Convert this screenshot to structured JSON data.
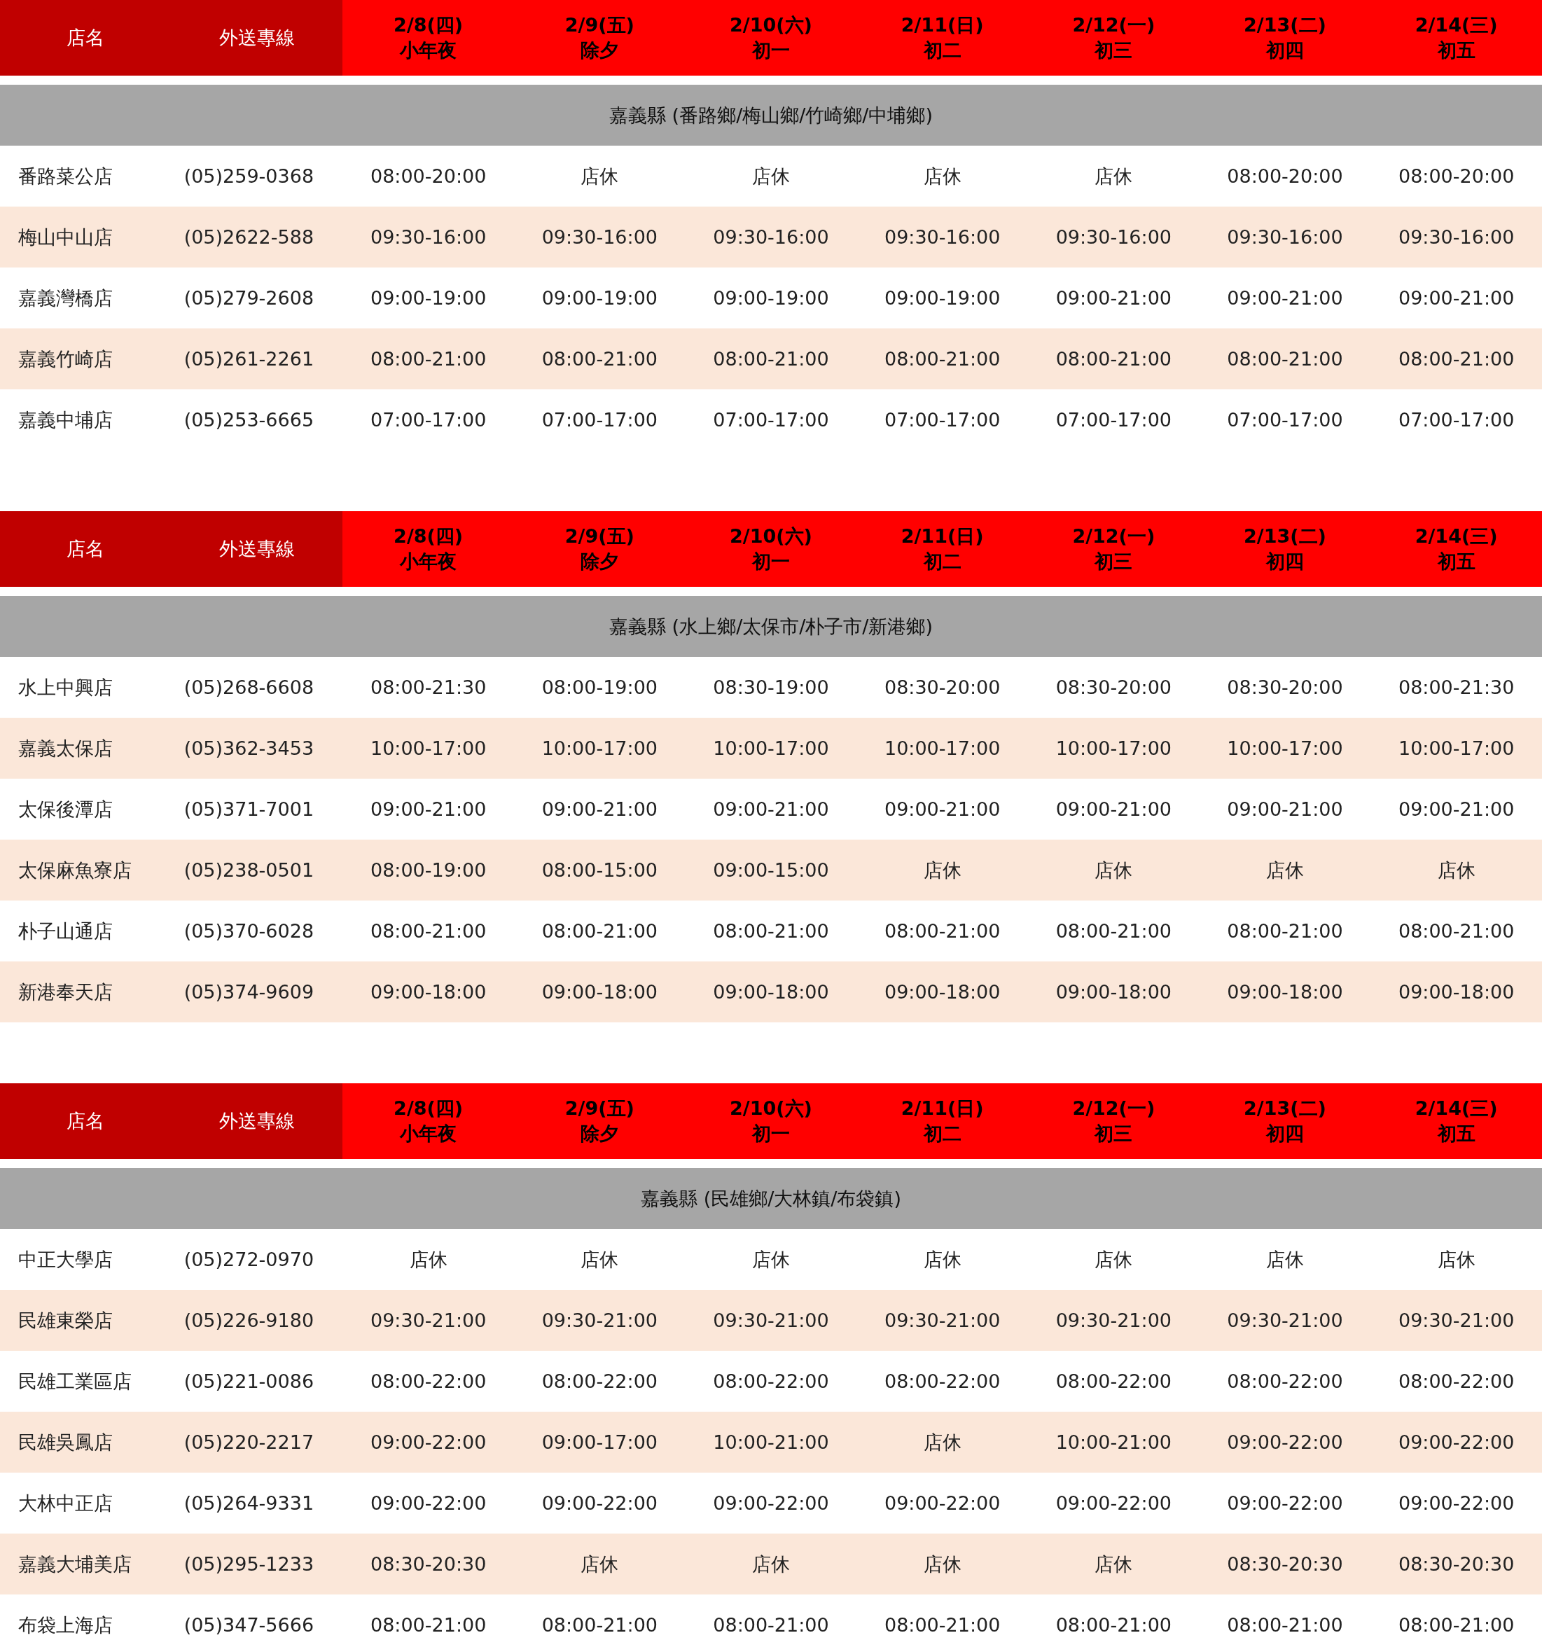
{
  "tables": [
    {
      "columns": [
        {
          "kind": "label",
          "lines": [
            "店名"
          ]
        },
        {
          "kind": "label",
          "lines": [
            "外送專線"
          ]
        },
        {
          "kind": "day",
          "lines": [
            "2/8(四)",
            "小年夜"
          ]
        },
        {
          "kind": "day",
          "lines": [
            "2/9(五)",
            "除夕"
          ]
        },
        {
          "kind": "day",
          "lines": [
            "2/10(六)",
            "初一"
          ]
        },
        {
          "kind": "day",
          "lines": [
            "2/11(日)",
            "初二"
          ]
        },
        {
          "kind": "day",
          "lines": [
            "2/12(一)",
            "初三"
          ]
        },
        {
          "kind": "day",
          "lines": [
            "2/13(二)",
            "初四"
          ]
        },
        {
          "kind": "day",
          "lines": [
            "2/14(三)",
            "初五"
          ]
        }
      ],
      "region": "嘉義縣 (番路鄉/梅山鄉/竹崎鄉/中埔鄉)",
      "rows": [
        {
          "name": "番路菜公店",
          "phone": "(05)259-0368",
          "hours": [
            "08:00-20:00",
            "店休",
            "店休",
            "店休",
            "店休",
            "08:00-20:00",
            "08:00-20:00"
          ]
        },
        {
          "name": "梅山中山店",
          "phone": "(05)2622-588",
          "hours": [
            "09:30-16:00",
            "09:30-16:00",
            "09:30-16:00",
            "09:30-16:00",
            "09:30-16:00",
            "09:30-16:00",
            "09:30-16:00"
          ]
        },
        {
          "name": "嘉義灣橋店",
          "phone": "(05)279-2608",
          "hours": [
            "09:00-19:00",
            "09:00-19:00",
            "09:00-19:00",
            "09:00-19:00",
            "09:00-21:00",
            "09:00-21:00",
            "09:00-21:00"
          ]
        },
        {
          "name": "嘉義竹崎店",
          "phone": "(05)261-2261",
          "hours": [
            "08:00-21:00",
            "08:00-21:00",
            "08:00-21:00",
            "08:00-21:00",
            "08:00-21:00",
            "08:00-21:00",
            "08:00-21:00"
          ]
        },
        {
          "name": "嘉義中埔店",
          "phone": "(05)253-6665",
          "hours": [
            "07:00-17:00",
            "07:00-17:00",
            "07:00-17:00",
            "07:00-17:00",
            "07:00-17:00",
            "07:00-17:00",
            "07:00-17:00"
          ]
        }
      ]
    },
    {
      "columns": [
        {
          "kind": "label",
          "lines": [
            "店名"
          ]
        },
        {
          "kind": "label",
          "lines": [
            "外送專線"
          ]
        },
        {
          "kind": "day",
          "lines": [
            "2/8(四)",
            "小年夜"
          ]
        },
        {
          "kind": "day",
          "lines": [
            "2/9(五)",
            "除夕"
          ]
        },
        {
          "kind": "day",
          "lines": [
            "2/10(六)",
            "初一"
          ]
        },
        {
          "kind": "day",
          "lines": [
            "2/11(日)",
            "初二"
          ]
        },
        {
          "kind": "day",
          "lines": [
            "2/12(一)",
            "初三"
          ]
        },
        {
          "kind": "day",
          "lines": [
            "2/13(二)",
            "初四"
          ]
        },
        {
          "kind": "day",
          "lines": [
            "2/14(三)",
            "初五"
          ]
        }
      ],
      "region": "嘉義縣 (水上鄉/太保市/朴子市/新港鄉)",
      "rows": [
        {
          "name": "水上中興店",
          "phone": "(05)268-6608",
          "hours": [
            "08:00-21:30",
            "08:00-19:00",
            "08:30-19:00",
            "08:30-20:00",
            "08:30-20:00",
            "08:30-20:00",
            "08:00-21:30"
          ]
        },
        {
          "name": "嘉義太保店",
          "phone": "(05)362-3453",
          "hours": [
            "10:00-17:00",
            "10:00-17:00",
            "10:00-17:00",
            "10:00-17:00",
            "10:00-17:00",
            "10:00-17:00",
            "10:00-17:00"
          ]
        },
        {
          "name": "太保後潭店",
          "phone": "(05)371-7001",
          "hours": [
            "09:00-21:00",
            "09:00-21:00",
            "09:00-21:00",
            "09:00-21:00",
            "09:00-21:00",
            "09:00-21:00",
            "09:00-21:00"
          ]
        },
        {
          "name": "太保麻魚寮店",
          "phone": "(05)238-0501",
          "hours": [
            "08:00-19:00",
            "08:00-15:00",
            "09:00-15:00",
            "店休",
            "店休",
            "店休",
            "店休"
          ]
        },
        {
          "name": "朴子山通店",
          "phone": "(05)370-6028",
          "hours": [
            "08:00-21:00",
            "08:00-21:00",
            "08:00-21:00",
            "08:00-21:00",
            "08:00-21:00",
            "08:00-21:00",
            "08:00-21:00"
          ]
        },
        {
          "name": "新港奉天店",
          "phone": "(05)374-9609",
          "hours": [
            "09:00-18:00",
            "09:00-18:00",
            "09:00-18:00",
            "09:00-18:00",
            "09:00-18:00",
            "09:00-18:00",
            "09:00-18:00"
          ]
        }
      ]
    },
    {
      "columns": [
        {
          "kind": "label",
          "lines": [
            "店名"
          ]
        },
        {
          "kind": "label",
          "lines": [
            "外送專線"
          ]
        },
        {
          "kind": "day",
          "lines": [
            "2/8(四)",
            "小年夜"
          ]
        },
        {
          "kind": "day",
          "lines": [
            "2/9(五)",
            "除夕"
          ]
        },
        {
          "kind": "day",
          "lines": [
            "2/10(六)",
            "初一"
          ]
        },
        {
          "kind": "day",
          "lines": [
            "2/11(日)",
            "初二"
          ]
        },
        {
          "kind": "day",
          "lines": [
            "2/12(一)",
            "初三"
          ]
        },
        {
          "kind": "day",
          "lines": [
            "2/13(二)",
            "初四"
          ]
        },
        {
          "kind": "day",
          "lines": [
            "2/14(三)",
            "初五"
          ]
        }
      ],
      "region": "嘉義縣 (民雄鄉/大林鎮/布袋鎮)",
      "rows": [
        {
          "name": "中正大學店",
          "phone": "(05)272-0970",
          "hours": [
            "店休",
            "店休",
            "店休",
            "店休",
            "店休",
            "店休",
            "店休"
          ]
        },
        {
          "name": "民雄東榮店",
          "phone": "(05)226-9180",
          "hours": [
            "09:30-21:00",
            "09:30-21:00",
            "09:30-21:00",
            "09:30-21:00",
            "09:30-21:00",
            "09:30-21:00",
            "09:30-21:00"
          ]
        },
        {
          "name": "民雄工業區店",
          "phone": "(05)221-0086",
          "hours": [
            "08:00-22:00",
            "08:00-22:00",
            "08:00-22:00",
            "08:00-22:00",
            "08:00-22:00",
            "08:00-22:00",
            "08:00-22:00"
          ]
        },
        {
          "name": "民雄吳鳳店",
          "phone": "(05)220-2217",
          "hours": [
            "09:00-22:00",
            "09:00-17:00",
            "10:00-21:00",
            "店休",
            "10:00-21:00",
            "09:00-22:00",
            "09:00-22:00"
          ]
        },
        {
          "name": "大林中正店",
          "phone": "(05)264-9331",
          "hours": [
            "09:00-22:00",
            "09:00-22:00",
            "09:00-22:00",
            "09:00-22:00",
            "09:00-22:00",
            "09:00-22:00",
            "09:00-22:00"
          ]
        },
        {
          "name": "嘉義大埔美店",
          "phone": "(05)295-1233",
          "hours": [
            "08:30-20:30",
            "店休",
            "店休",
            "店休",
            "店休",
            "08:30-20:30",
            "08:30-20:30"
          ]
        },
        {
          "name": "布袋上海店",
          "phone": "(05)347-5666",
          "hours": [
            "08:00-21:00",
            "08:00-21:00",
            "08:00-21:00",
            "08:00-21:00",
            "08:00-21:00",
            "08:00-21:00",
            "08:00-21:00"
          ]
        }
      ]
    }
  ]
}
